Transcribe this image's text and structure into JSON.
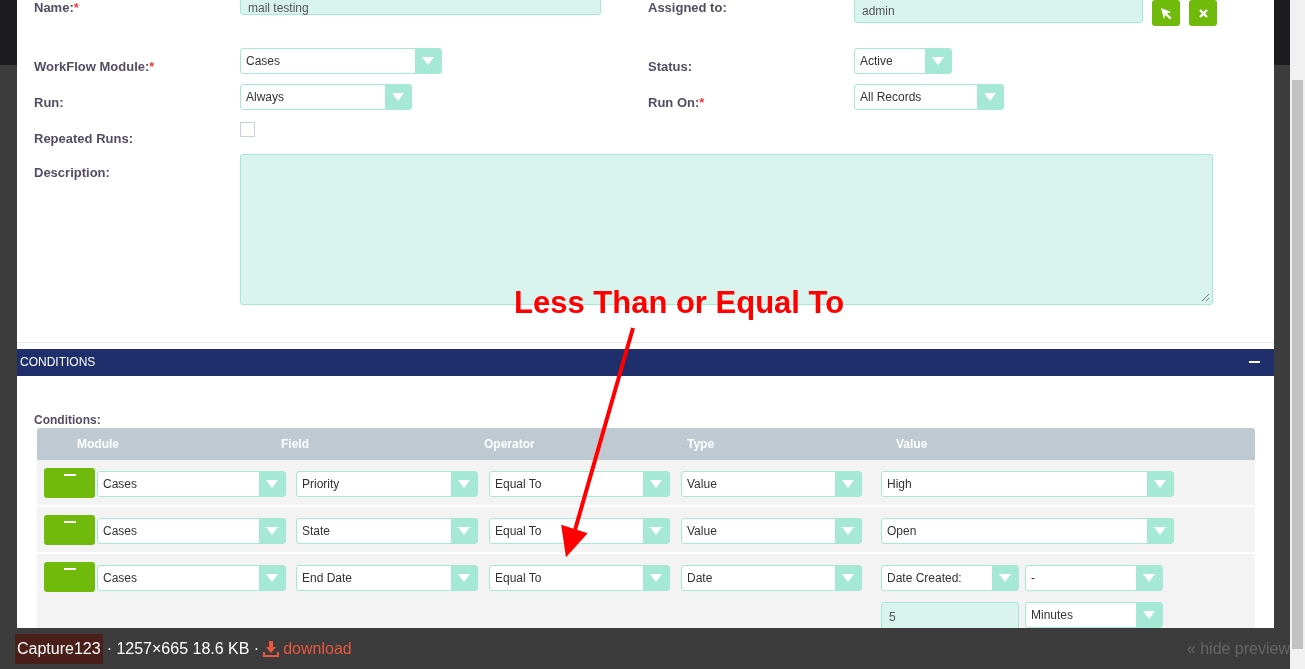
{
  "form": {
    "rows": [
      {
        "cells": [
          {
            "label": "Name:",
            "required_mark": "*",
            "kind": "text",
            "value": "mail testing"
          },
          {
            "label": "Assigned to:",
            "kind": "relate",
            "value": "admin"
          }
        ]
      },
      {
        "cells": [
          {
            "label": "WorkFlow Module:",
            "required_mark": "*",
            "kind": "select",
            "value": "Cases"
          },
          {
            "label": "Status:",
            "kind": "select",
            "value": "Active"
          }
        ]
      },
      {
        "cells": [
          {
            "label": "Run:",
            "kind": "select",
            "value": "Always"
          },
          {
            "label": "Run On:",
            "required_mark": "*",
            "kind": "select",
            "value": "All Records"
          }
        ]
      },
      {
        "cells": [
          {
            "label": "Repeated Runs:",
            "kind": "checkbox",
            "checked": false
          }
        ]
      },
      {
        "cells": [
          {
            "label": "Description:",
            "kind": "textarea"
          }
        ]
      }
    ]
  },
  "conditions_panel": {
    "title": "CONDITIONS",
    "expanded": true,
    "label": "Conditions:",
    "columns": [
      "Module",
      "Field",
      "Operator",
      "Type",
      "Value"
    ],
    "rows": [
      {
        "module": "Cases",
        "field": "Priority",
        "operator": "Equal To",
        "type": "Value",
        "value": [
          {
            "kind": "select",
            "value": "High"
          }
        ]
      },
      {
        "module": "Cases",
        "field": "State",
        "operator": "Equal To",
        "type": "Value",
        "value": [
          {
            "kind": "select",
            "value": "Open"
          }
        ]
      },
      {
        "module": "Cases",
        "field": "End Date",
        "operator": "Equal To",
        "type": "Date",
        "value": [
          {
            "kind": "select",
            "value": "Date Created:"
          },
          {
            "kind": "select",
            "value": "-"
          },
          {
            "kind": "input",
            "value": "5"
          },
          {
            "kind": "select",
            "value": "Minutes"
          }
        ]
      }
    ]
  },
  "annotation": {
    "text": "Less Than or Equal To"
  },
  "preview_bar": {
    "file_name": "Capture123",
    "info": "· 1257×665 18.6 KB ·",
    "download": "download",
    "hide": "« hide preview"
  }
}
